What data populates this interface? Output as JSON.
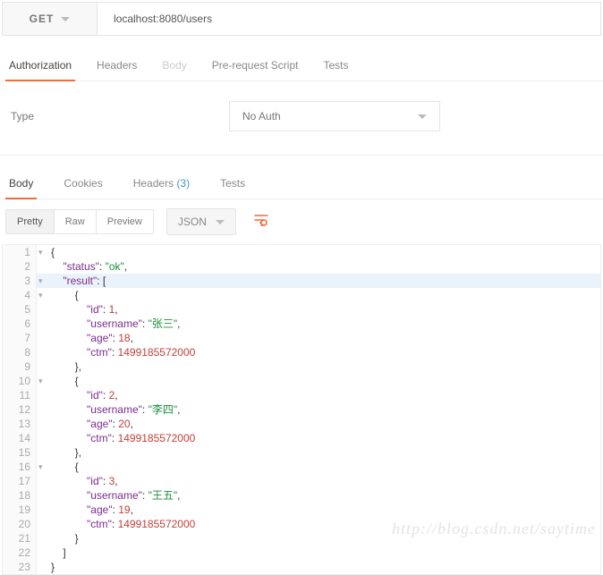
{
  "request": {
    "method": "GET",
    "url": "localhost:8080/users"
  },
  "main_tabs": [
    {
      "label": "Authorization",
      "state": "active"
    },
    {
      "label": "Headers",
      "state": ""
    },
    {
      "label": "Body",
      "state": "disabled"
    },
    {
      "label": "Pre-request Script",
      "state": ""
    },
    {
      "label": "Tests",
      "state": ""
    }
  ],
  "auth": {
    "type_label": "Type",
    "selected": "No Auth"
  },
  "response_tabs": {
    "body": "Body",
    "cookies": "Cookies",
    "headers": "Headers",
    "headers_count": "(3)",
    "tests": "Tests"
  },
  "toolbar": {
    "pretty": "Pretty",
    "raw": "Raw",
    "preview": "Preview",
    "format": "JSON"
  },
  "response_body": {
    "status": "ok",
    "result": [
      {
        "id": 1,
        "username": "张三",
        "age": 18,
        "ctm": 1499185572000
      },
      {
        "id": 2,
        "username": "李四",
        "age": 20,
        "ctm": 1499185572000
      },
      {
        "id": 3,
        "username": "王五",
        "age": 19,
        "ctm": 1499185572000
      }
    ]
  },
  "keys": {
    "status": "status",
    "result": "result",
    "id": "id",
    "username": "username",
    "age": "age",
    "ctm": "ctm"
  },
  "watermark": "http://blog.csdn.net/saytime"
}
